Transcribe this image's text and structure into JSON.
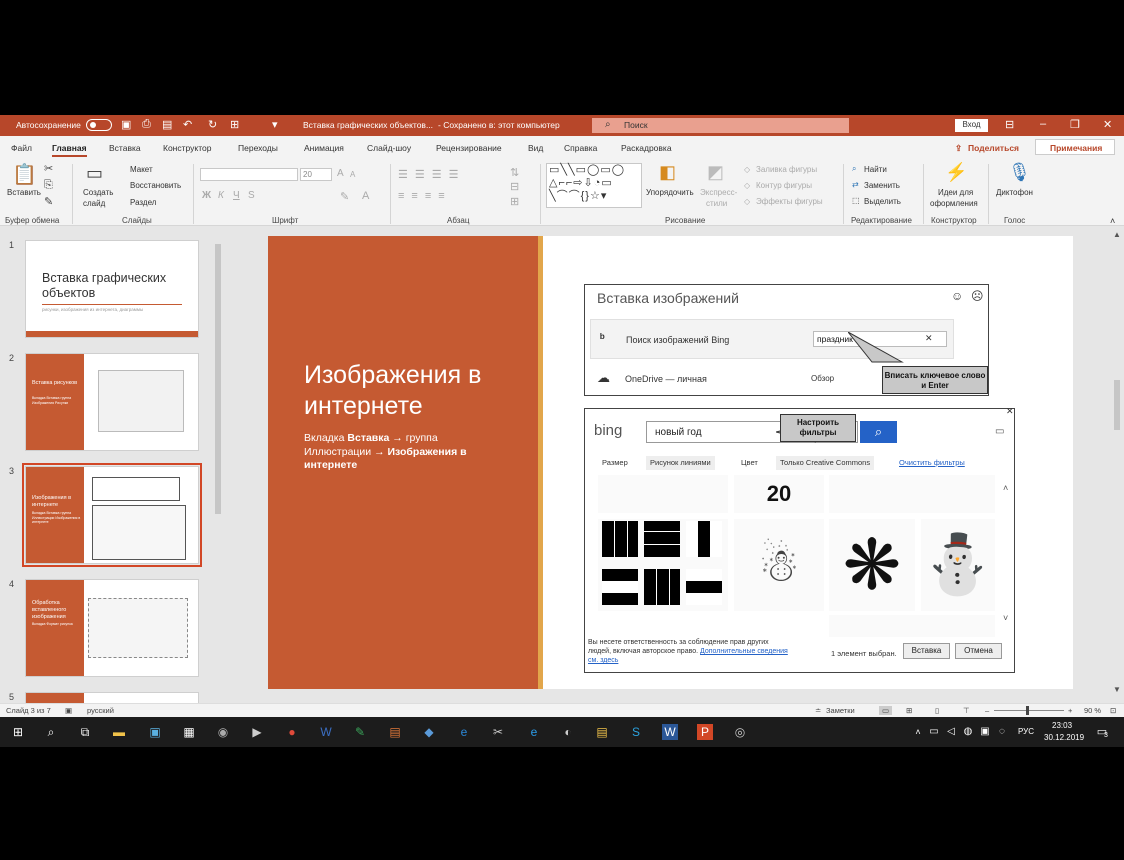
{
  "titlebar": {
    "autosave_label": "Автосохранение",
    "doc_title": "Вставка графических объектов...",
    "saved_status": "- Сохранено в: этот компьютер",
    "search_placeholder": "Поиск",
    "login_label": "Вход"
  },
  "menu": {
    "tabs": [
      "Файл",
      "Главная",
      "Вставка",
      "Конструктор",
      "Переходы",
      "Анимация",
      "Слайд-шоу",
      "Рецензирование",
      "Вид",
      "Справка",
      "Раскадровка"
    ],
    "share_label": "Поделиться",
    "comments_label": "Примечания"
  },
  "ribbon": {
    "clipboard": {
      "paste": "Вставить",
      "group": "Буфер обмена"
    },
    "slides": {
      "new_slide_1": "Создать",
      "new_slide_2": "слайд",
      "layout": "Макет",
      "reset": "Восстановить",
      "section": "Раздел",
      "group": "Слайды"
    },
    "font": {
      "size": "20",
      "bold": "Ж",
      "italic": "К",
      "underline": "Ч",
      "strike": "S",
      "group": "Шрифт"
    },
    "paragraph": {
      "group": "Абзац"
    },
    "drawing": {
      "arrange_1": "Упорядочить",
      "quick_styles_1": "Экспресс-",
      "quick_styles_2": "стили",
      "fill": "Заливка фигуры",
      "outline": "Контур фигуры",
      "effects": "Эффекты фигуры",
      "group": "Рисование"
    },
    "editing": {
      "find": "Найти",
      "replace": "Заменить",
      "select": "Выделить",
      "group": "Редактирование"
    },
    "designer": {
      "ideas_1": "Идеи для",
      "ideas_2": "оформления",
      "group": "Конструктор"
    },
    "voice": {
      "dictate": "Диктофон",
      "group": "Голос"
    }
  },
  "thumbnails": [
    {
      "num": "1",
      "title": "Вставка графических объектов",
      "subtitle": "рисунки, изображения из интернета, диаграммы"
    },
    {
      "num": "2",
      "title": "Вставка рисунков",
      "sub": "Вкладка Вставка группа Изображения Рисунки"
    },
    {
      "num": "3",
      "title": "Изображения в интернете",
      "sub": "Вкладка Вставка группа Иллюстрации Изображения в интернете"
    },
    {
      "num": "4",
      "title": "Обработка вставленного изображения",
      "sub": "Вкладка Формат рисунка"
    },
    {
      "num": "5"
    }
  ],
  "slide": {
    "title": "Изображения в интернете",
    "sub_pre": "Вкладка ",
    "sub_b1": "Вставка",
    "sub_mid": " → группа Иллюстрации → ",
    "sub_b2": "Изображения в интернете",
    "insert_dialog": {
      "title": "Вставка изображений",
      "bing_label": "Поиск изображений Bing",
      "bing_query": "праздник",
      "onedrive_label": "OneDrive — личная",
      "browse_label": "Обзор"
    },
    "callout_keyword": "Вписать ключевое слово и Enter",
    "callout_filters": "Настроить фильтры",
    "bing_dialog": {
      "logo": "bing",
      "query": "новый год",
      "filters": [
        "Размер",
        "Рисунок линиями",
        "Цвет",
        "Только Creative Commons"
      ],
      "clear_filters": "Очистить фильтры",
      "notice": "Вы несете ответственность за соблюдение прав других людей, включая авторское право.",
      "notice_link": "Дополнительные сведения см. здесь",
      "selected_count": "1 элемент выбран.",
      "insert_button": "Вставка",
      "cancel_button": "Отмена",
      "image_number": "20"
    }
  },
  "statusbar": {
    "slide_info": "Слайд 3 из 7",
    "language": "русский",
    "notes_label": "Заметки",
    "zoom": "90 %"
  },
  "taskbar": {
    "lang": "РУС",
    "time": "23:03",
    "date": "30.12.2019",
    "notifications": "3"
  }
}
